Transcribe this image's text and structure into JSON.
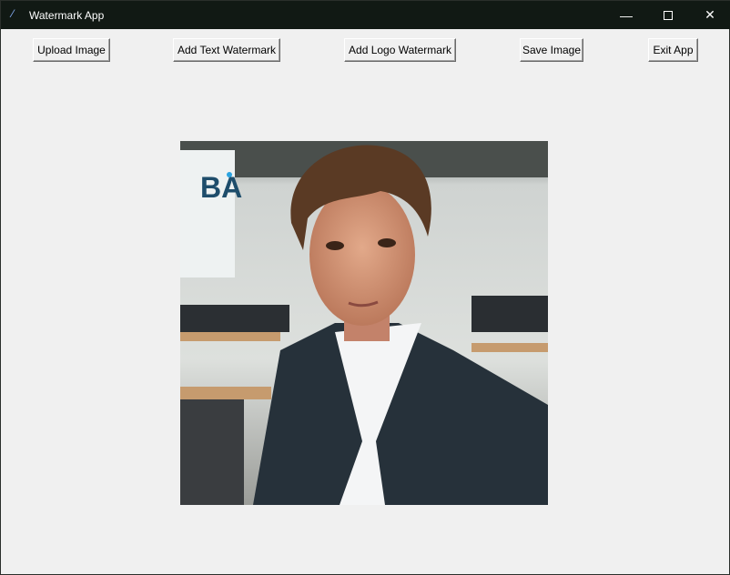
{
  "window": {
    "title": "Watermark App",
    "icon": "feather-icon",
    "controls": [
      "minimize-icon",
      "maximize-icon",
      "close-icon"
    ]
  },
  "toolbar": {
    "upload": "Upload Image",
    "add_text": "Add Text Watermark",
    "add_logo": "Add Logo Watermark",
    "save": "Save Image",
    "exit": "Exit App"
  },
  "image": {
    "description_icon": "portrait-photo",
    "watermark_logo": "BA"
  }
}
